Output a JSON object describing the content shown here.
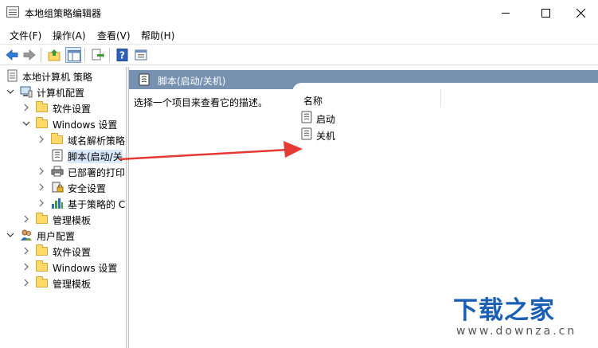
{
  "window": {
    "title": "本地组策略编辑器",
    "minimize_icon": "minimize-icon",
    "maximize_icon": "maximize-icon",
    "close_icon": "close-icon"
  },
  "menubar": {
    "items": [
      "文件(F)",
      "操作(A)",
      "查看(V)",
      "帮助(H)"
    ]
  },
  "toolbar": {
    "icons": [
      "back-icon",
      "forward-icon",
      "up-folder-icon",
      "show-hide-tree-icon",
      "export-list-icon",
      "help-icon",
      "properties-icon"
    ]
  },
  "tree": {
    "items": [
      {
        "label": "本地计算机 策略",
        "icon": "policy-doc-icon"
      },
      {
        "label": "计算机配置",
        "icon": "computer-icon"
      },
      {
        "label": "软件设置",
        "icon": "folder-icon"
      },
      {
        "label": "Windows 设置",
        "icon": "folder-icon"
      },
      {
        "label": "域名解析策略",
        "icon": "folder-icon"
      },
      {
        "label": "脚本(启动/关",
        "icon": "script-icon"
      },
      {
        "label": "已部署的打印",
        "icon": "printer-icon"
      },
      {
        "label": "安全设置",
        "icon": "security-icon"
      },
      {
        "label": "基于策略的 C",
        "icon": "chart-icon"
      },
      {
        "label": "管理模板",
        "icon": "folder-icon"
      },
      {
        "label": "用户配置",
        "icon": "user-icon"
      },
      {
        "label": "软件设置",
        "icon": "folder-icon"
      },
      {
        "label": "Windows 设置",
        "icon": "folder-icon"
      },
      {
        "label": "管理模板",
        "icon": "folder-icon"
      }
    ]
  },
  "right": {
    "header": "脚本(启动/关机)",
    "description": "选择一个项目来查看它的描述。",
    "column_name": "名称",
    "items": [
      "启动",
      "关机"
    ]
  },
  "watermark": {
    "main": "下载之家",
    "sub": "www.downza.cn"
  },
  "colors": {
    "header_band": "#7791b1",
    "arrow": "#e53935",
    "watermark": "#1a5fb4"
  }
}
